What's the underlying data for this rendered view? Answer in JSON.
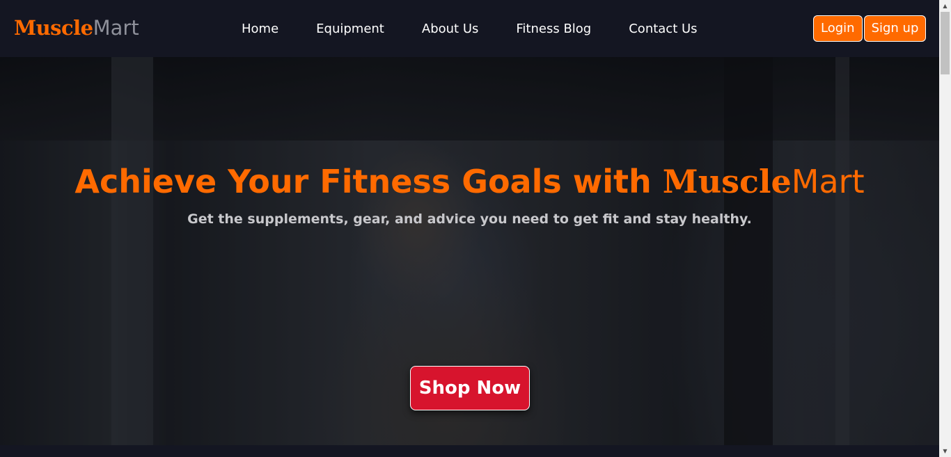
{
  "brand": {
    "part1": "Muscle",
    "part2": "Mart"
  },
  "nav": {
    "items": [
      {
        "label": "Home"
      },
      {
        "label": "Equipment"
      },
      {
        "label": "About Us"
      },
      {
        "label": "Fitness Blog"
      },
      {
        "label": "Contact Us"
      }
    ]
  },
  "auth": {
    "login_label": "Login",
    "signup_label": "Sign up"
  },
  "hero": {
    "title_prefix": "Achieve Your Fitness Goals with ",
    "title_brand_part1": "Muscle",
    "title_brand_part2": "Mart",
    "subtitle": "Get the supplements, gear, and advice you need to get fit and stay healthy.",
    "cta_label": "Shop Now"
  },
  "colors": {
    "accent": "#ff6a00",
    "cta": "#d7142d",
    "nav_background": "#141622"
  },
  "scrollbar": {
    "up_icon": "▲",
    "down_icon": "▼"
  }
}
